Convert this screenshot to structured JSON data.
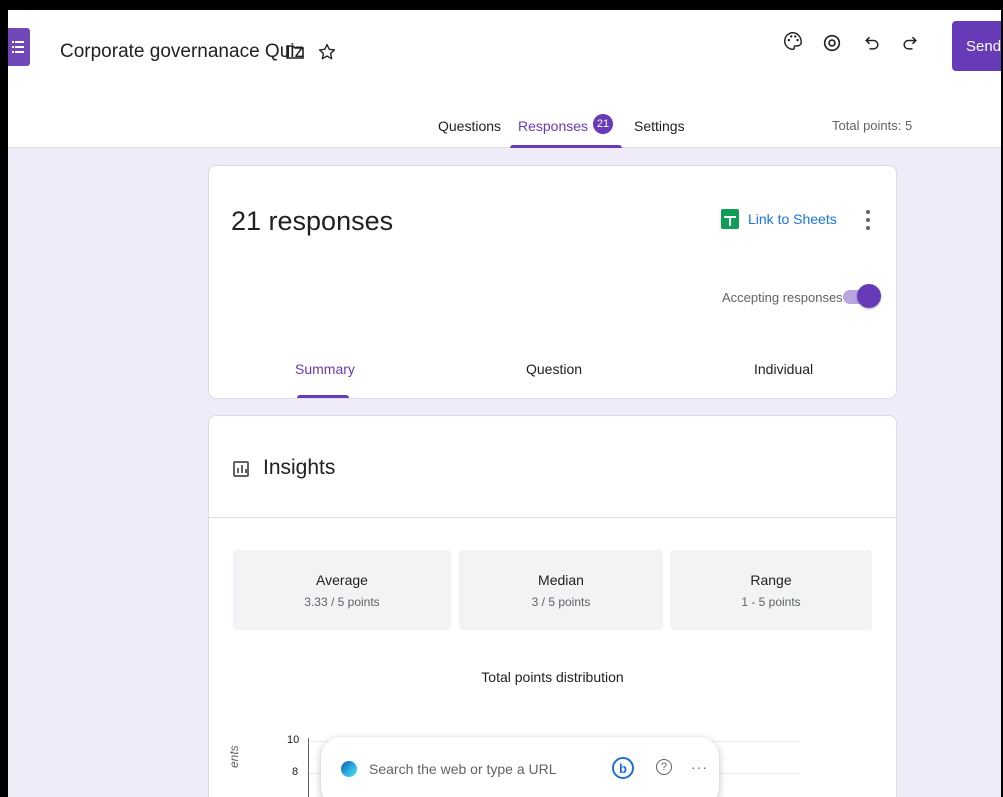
{
  "app": {
    "doc_title": "Corporate governanace Quiz",
    "send_label": "Send"
  },
  "tabs": {
    "questions": "Questions",
    "responses": "Responses",
    "responses_count": "21",
    "settings": "Settings",
    "total_points": "Total points: 5"
  },
  "responses_card": {
    "title": "21 responses",
    "link_to_sheets": "Link to Sheets",
    "accepting_label": "Accepting responses",
    "accepting_on": true,
    "subtabs": [
      "Summary",
      "Question",
      "Individual"
    ],
    "active_subtab": "Summary"
  },
  "insights": {
    "title": "Insights",
    "stats": [
      {
        "label": "Average",
        "value": "3.33 / 5 points"
      },
      {
        "label": "Median",
        "value": "3 / 5 points"
      },
      {
        "label": "Range",
        "value": "1 - 5 points"
      }
    ],
    "distribution_title": "Total points distribution",
    "y_ticks": [
      "10",
      "8"
    ],
    "y_label_fragment": "ents"
  },
  "edge_search": {
    "placeholder": "Search the web or type a URL",
    "bing_glyph": "b",
    "help_glyph": "?",
    "more_glyph": "···"
  },
  "icons": {
    "forms_logo": "google-forms-icon",
    "folder": "folder-icon",
    "star": "star-icon",
    "palette": "palette-icon",
    "preview": "eye-icon",
    "undo": "undo-icon",
    "redo": "redo-icon"
  },
  "colors": {
    "accent": "#673ab7",
    "background": "#f0ebf8",
    "link": "#1a73e8",
    "sheets_green": "#0f9d58"
  }
}
